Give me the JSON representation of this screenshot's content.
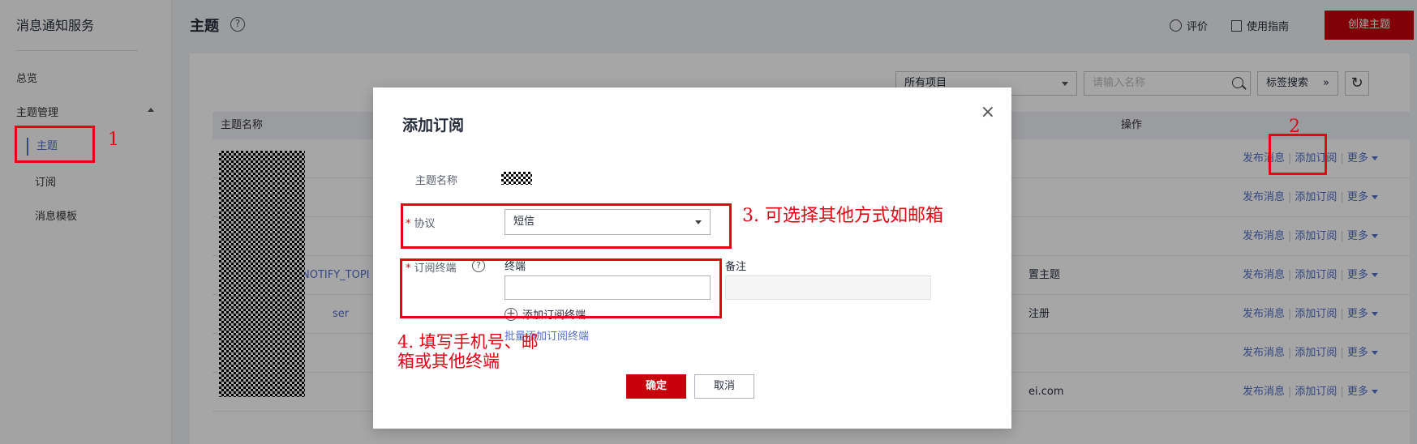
{
  "sidebar": {
    "title": "消息通知服务",
    "overview": "总览",
    "group": "主题管理",
    "items": [
      {
        "label": "主题"
      },
      {
        "label": "订阅"
      },
      {
        "label": "消息模板"
      }
    ]
  },
  "header": {
    "title": "主题",
    "help": "?",
    "rate": "评价",
    "guide": "使用指南",
    "create": "创建主题"
  },
  "toolbar": {
    "project_select": "所有项目",
    "search_placeholder": "请输入名称",
    "tag_search": "标签搜索"
  },
  "table": {
    "col_name": "主题名称",
    "col_ops": "操作",
    "fragments": {
      "row4_name": "NOTIFY_TOPI",
      "row4_desc": "置主题",
      "row5_name": "ser",
      "row5_desc": "注册",
      "row7_desc": "ei.com"
    },
    "op_publish": "发布消息",
    "op_subscribe": "添加订阅",
    "op_more": "更多"
  },
  "modal": {
    "title": "添加订阅",
    "close": "×",
    "topic_label": "主题名称",
    "protocol_label": "协议",
    "protocol_value": "短信",
    "endpoint_label": "订阅终端",
    "endpoint_col": "终端",
    "remark_col": "备注",
    "add_endpoint": "添加订阅终端",
    "batch_add": "批量添加订阅终端",
    "ok": "确定",
    "cancel": "取消",
    "required_mark": "*"
  },
  "annotations": {
    "a1": "1",
    "a2": "2",
    "a3": "3. 可选择其他方式如邮箱",
    "a4_line1": "4. 填写手机号、邮",
    "a4_line2": "箱或其他终端"
  },
  "colors": {
    "brand_red": "#c7000b",
    "link_blue": "#526ecc",
    "annotation_red": "#e60012"
  }
}
